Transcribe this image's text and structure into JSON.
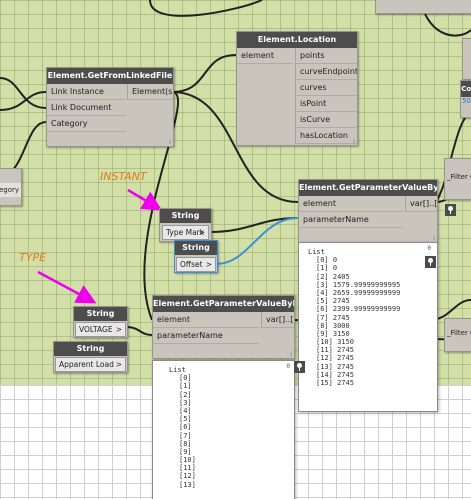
{
  "nodes": {
    "get_from_linked_file": {
      "title": "Element.GetFromLinkedFile",
      "inputs": [
        "Link Instance",
        "Link Document",
        "Category"
      ],
      "output": "Element(s)"
    },
    "location": {
      "title": "Element.Location",
      "input": "element",
      "outputs": [
        "points",
        "curveEndpoints",
        "curves",
        "isPoint",
        "isCurve",
        "hasLocation"
      ]
    },
    "gpv_top": {
      "title": "Element.GetParameterValueByName",
      "inputs": [
        "element",
        "parameterName"
      ],
      "output": "var[]..[]"
    },
    "gpv_bottom": {
      "title": "Element.GetParameterValueByName",
      "inputs": [
        "element",
        "parameterName"
      ],
      "output": "var[]..[]"
    },
    "string_type_mark": {
      "title": "String",
      "value": "Type Mark",
      "arrow": ">"
    },
    "string_offset": {
      "title": "String",
      "value": "Offset",
      "arrow": ">"
    },
    "string_voltage": {
      "title": "String",
      "value": "VOLTAGE",
      "arrow": ">"
    },
    "string_apparent_load": {
      "title": "String",
      "value": "Apparent Load",
      "arrow": ">"
    },
    "edge_left_category": "egory",
    "edge_right_filter_top": "_Filter C",
    "edge_right_filter_bottom": "_Filter C",
    "edge_right_cor": "Cor",
    "edge_right_num": "50"
  },
  "annotations": {
    "instant": "INSTANT",
    "type": "TYPE"
  },
  "watch_top": {
    "header": "List",
    "count": "0",
    "items": [
      "[0] 0",
      "[1] 0",
      "[2] 2405",
      "[3] 1579.99999999995",
      "[4] 2659.99999999999",
      "[5] 2745",
      "[6] 2399.99999999999",
      "[7] 2745",
      "[8] 3000",
      "[9] 3150",
      "[10] 3150",
      "[11] 2745",
      "[12] 2745",
      "[13] 2745",
      "[14] 2745",
      "[15] 2745"
    ]
  },
  "watch_bottom": {
    "header": "List",
    "count": "0",
    "items": [
      "[0]",
      "[1]",
      "[2]",
      "[3]",
      "[4]",
      "[5]",
      "[6]",
      "[7]",
      "[8]",
      "[9]",
      "[10]",
      "[11]",
      "[12]",
      "[13]"
    ]
  },
  "colors": {
    "canvas": "#d2e0a8",
    "wire": "#222222",
    "selected_wire": "#3a8fd8",
    "arrow": "#ee00ee",
    "annotation": "#e07b1a"
  }
}
